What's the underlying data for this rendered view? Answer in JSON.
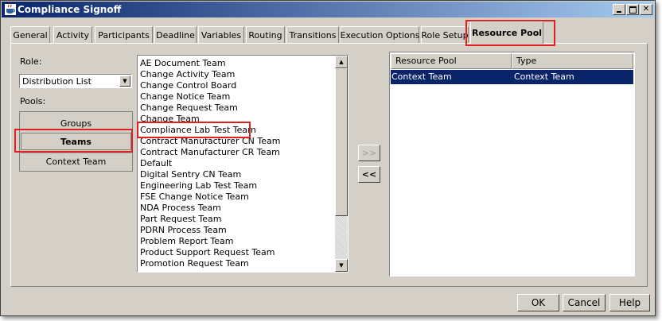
{
  "window": {
    "title": "Compliance Signoff"
  },
  "tabs": [
    {
      "label": "General"
    },
    {
      "label": "Activity"
    },
    {
      "label": "Participants"
    },
    {
      "label": "Deadline"
    },
    {
      "label": "Variables"
    },
    {
      "label": "Routing"
    },
    {
      "label": "Transitions"
    },
    {
      "label": "Execution Options"
    },
    {
      "label": "Role Setup"
    },
    {
      "label": "Resource Pool",
      "active": true
    }
  ],
  "role": {
    "label": "Role:",
    "selected": "Distribution List"
  },
  "pools": {
    "label": "Pools:",
    "items": [
      {
        "label": "Groups"
      },
      {
        "label": "Teams",
        "selected": true
      },
      {
        "label": "Context Team"
      }
    ]
  },
  "available_list": {
    "items": [
      "AE Document Team",
      "Change Activity Team",
      "Change Control Board",
      "Change Notice Team",
      "Change Request Team",
      "Change Team",
      "Compliance Lab Test Team",
      "Contract Manufacturer CN Team",
      "Contract Manufacturer CR Team",
      "Default",
      "Digital Sentry CN Team",
      "Engineering Lab Test Team",
      "FSE Change Notice Team",
      "NDA Process Team",
      "Part Request Team",
      "PDRN Process Team",
      "Problem Report Team",
      "Product Support Request Team",
      "Promotion Request Team"
    ]
  },
  "move_buttons": {
    "add": ">>",
    "remove": "<<"
  },
  "resource_table": {
    "columns": [
      "Resource Pool",
      "Type"
    ],
    "rows": [
      {
        "pool": "Context Team",
        "type": "Context Team"
      }
    ]
  },
  "footer": {
    "ok": "OK",
    "cancel": "Cancel",
    "help": "Help"
  },
  "colors": {
    "highlight": "#e02020",
    "selection": "#0a246a"
  }
}
